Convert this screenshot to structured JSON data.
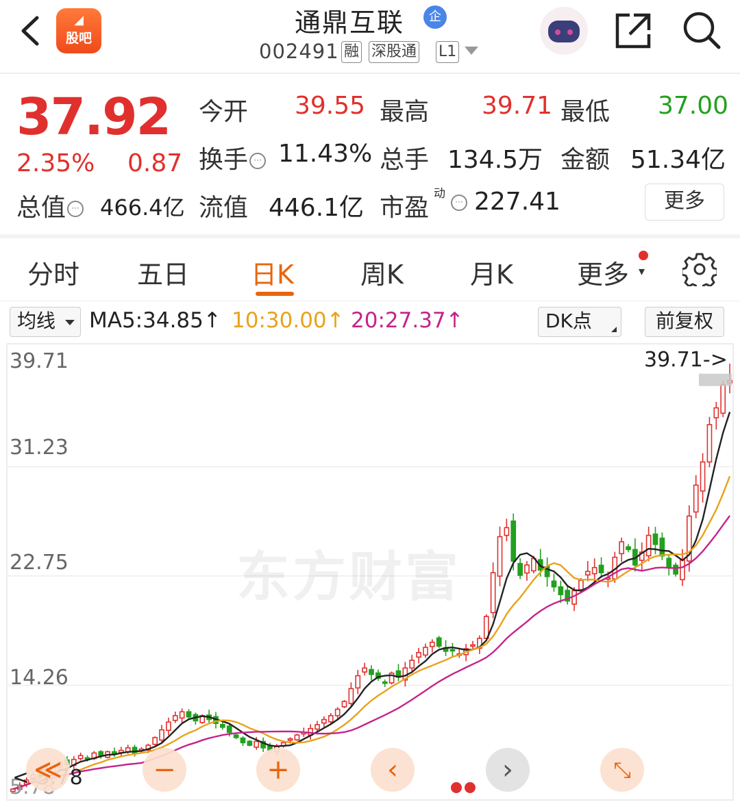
{
  "header": {
    "app_badge": "股吧",
    "stock_name": "通鼎互联",
    "ent_badge": "企",
    "code": "002491",
    "tags": [
      "融",
      "深股通",
      "L1"
    ]
  },
  "quote": {
    "price": "37.92",
    "change_pct": "2.35%",
    "change": "0.87",
    "open_label": "今开",
    "open_value": "39.55",
    "high_label": "最高",
    "high_value": "39.71",
    "low_label": "最低",
    "low_value": "37.00",
    "turnover_label": "换手",
    "turnover_value": "11.43%",
    "volume_label": "总手",
    "volume_value": "134.5万",
    "amount_label": "金额",
    "amount_value": "51.34亿",
    "mktcap_label": "总值",
    "mktcap_value": "466.4亿",
    "float_label": "流值",
    "float_value": "446.1亿",
    "pe_label": "市盈",
    "pe_sup": "动",
    "pe_value": "227.41",
    "more_label": "更多"
  },
  "tabs": [
    "分时",
    "五日",
    "日K",
    "周K",
    "月K",
    "更多"
  ],
  "ma_bar": {
    "select_label": "均线",
    "ma5": "MA5:34.85↑",
    "ma10": "10:30.00↑",
    "ma20": "20:27.37↑",
    "dk_label": "DK点",
    "adjust_label": "前复权"
  },
  "chart": {
    "watermark": "东方财富",
    "y_ticks": [
      "39.71",
      "31.23",
      "22.75",
      "14.26",
      "5.78"
    ],
    "max_label": "39.71->",
    "min_label": "<-5.78"
  },
  "controls": {
    "rewind": "≪",
    "zoom_out": "−",
    "zoom_in": "+",
    "prev": "‹",
    "next": "›",
    "fullscreen": "⤡"
  },
  "colors": {
    "up": "#e0302e",
    "down": "#23a01f",
    "accent": "#e8650d",
    "ma5": "#222222",
    "ma10": "#e8a21a",
    "ma20": "#c4238b"
  },
  "chart_data": {
    "type": "candlestick",
    "ylim": [
      5.78,
      39.71
    ],
    "ma_labels": [
      "MA5",
      "10",
      "20"
    ],
    "closes_approx": [
      6.2,
      6.5,
      6.9,
      7.3,
      7.1,
      7.6,
      7.9,
      8.3,
      8.1,
      8.5,
      8.8,
      8.6,
      9.0,
      8.8,
      9.1,
      8.9,
      9.2,
      9.4,
      9.0,
      9.3,
      9.6,
      10.2,
      10.8,
      11.4,
      11.9,
      12.2,
      11.8,
      11.5,
      11.9,
      11.6,
      11.3,
      11.0,
      10.6,
      10.2,
      9.8,
      9.6,
      9.9,
      9.4,
      9.2,
      9.5,
      9.8,
      10.1,
      10.4,
      10.6,
      10.9,
      11.2,
      11.6,
      11.9,
      12.4,
      13.0,
      14.0,
      15.0,
      15.6,
      15.1,
      14.8,
      14.5,
      15.2,
      14.9,
      15.6,
      16.2,
      16.8,
      17.2,
      17.6,
      17.3,
      16.9,
      17.0,
      16.7,
      17.1,
      17.4,
      17.9,
      19.6,
      23.0,
      25.8,
      26.5,
      23.9,
      22.8,
      23.6,
      24.1,
      23.2,
      22.7,
      21.9,
      21.3,
      20.8,
      21.6,
      22.4,
      23.1,
      23.4,
      23.0,
      22.6,
      24.2,
      25.4,
      24.8,
      23.6,
      24.6,
      25.9,
      25.2,
      24.3,
      23.4,
      22.9,
      24.0,
      27.4,
      29.8,
      31.6,
      34.5,
      35.8,
      37.6,
      37.92
    ]
  }
}
